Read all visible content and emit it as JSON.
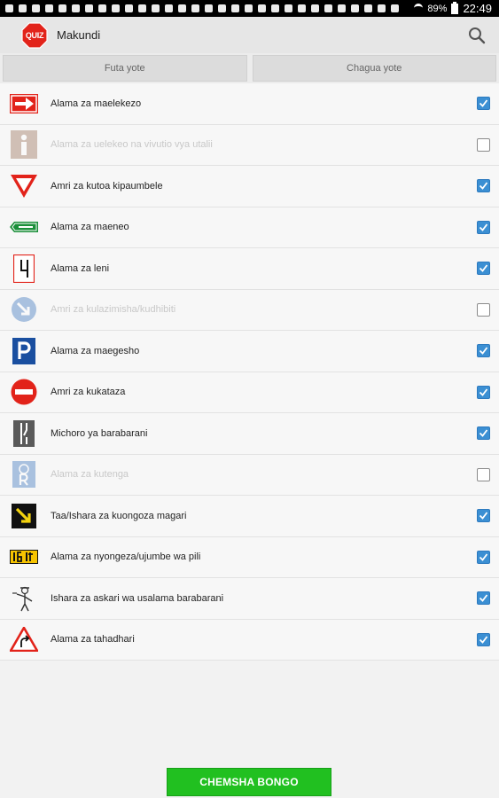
{
  "status_bar": {
    "battery": "89%",
    "time": "22:49"
  },
  "app": {
    "logo_text": "QUIZ",
    "title": "Makundi"
  },
  "buttons": {
    "deselect_all": "Futa yote",
    "select_all": "Chagua yote"
  },
  "categories": [
    {
      "label": "Alama za maelekezo",
      "checked": true,
      "icon": "direction-arrow-sign-icon"
    },
    {
      "label": "Alama za uelekeo na vivutio vya utalii",
      "checked": false,
      "icon": "info-tourism-sign-icon"
    },
    {
      "label": "Amri za kutoa kipaumbele",
      "checked": true,
      "icon": "yield-sign-icon"
    },
    {
      "label": "Alama za maeneo",
      "checked": true,
      "icon": "area-sign-icon"
    },
    {
      "label": "Alama za leni",
      "checked": true,
      "icon": "lane-sign-icon"
    },
    {
      "label": "Amri za kulazimisha/kudhibiti",
      "checked": false,
      "icon": "mandatory-arrow-sign-icon"
    },
    {
      "label": "Alama za maegesho",
      "checked": true,
      "icon": "parking-sign-icon"
    },
    {
      "label": "Amri za kukataza",
      "checked": true,
      "icon": "no-entry-sign-icon"
    },
    {
      "label": "Michoro ya barabarani",
      "checked": true,
      "icon": "road-marking-icon"
    },
    {
      "label": "Alama za kutenga",
      "checked": false,
      "icon": "reserved-sign-icon"
    },
    {
      "label": "Taa/Ishara za kuongoza magari",
      "checked": true,
      "icon": "traffic-light-signal-icon"
    },
    {
      "label": "Alama za nyongeza/ujumbe wa pili",
      "checked": true,
      "icon": "supplementary-plate-icon"
    },
    {
      "label": "Ishara za askari wa usalama barabarani",
      "checked": true,
      "icon": "traffic-officer-icon"
    },
    {
      "label": "Alama za tahadhari",
      "checked": true,
      "icon": "warning-triangle-icon"
    }
  ],
  "action": {
    "start_label": "CHEMSHA BONGO"
  },
  "colors": {
    "accent_green": "#21c020",
    "check_blue": "#3b8fd3",
    "logo_red": "#e2231a"
  }
}
